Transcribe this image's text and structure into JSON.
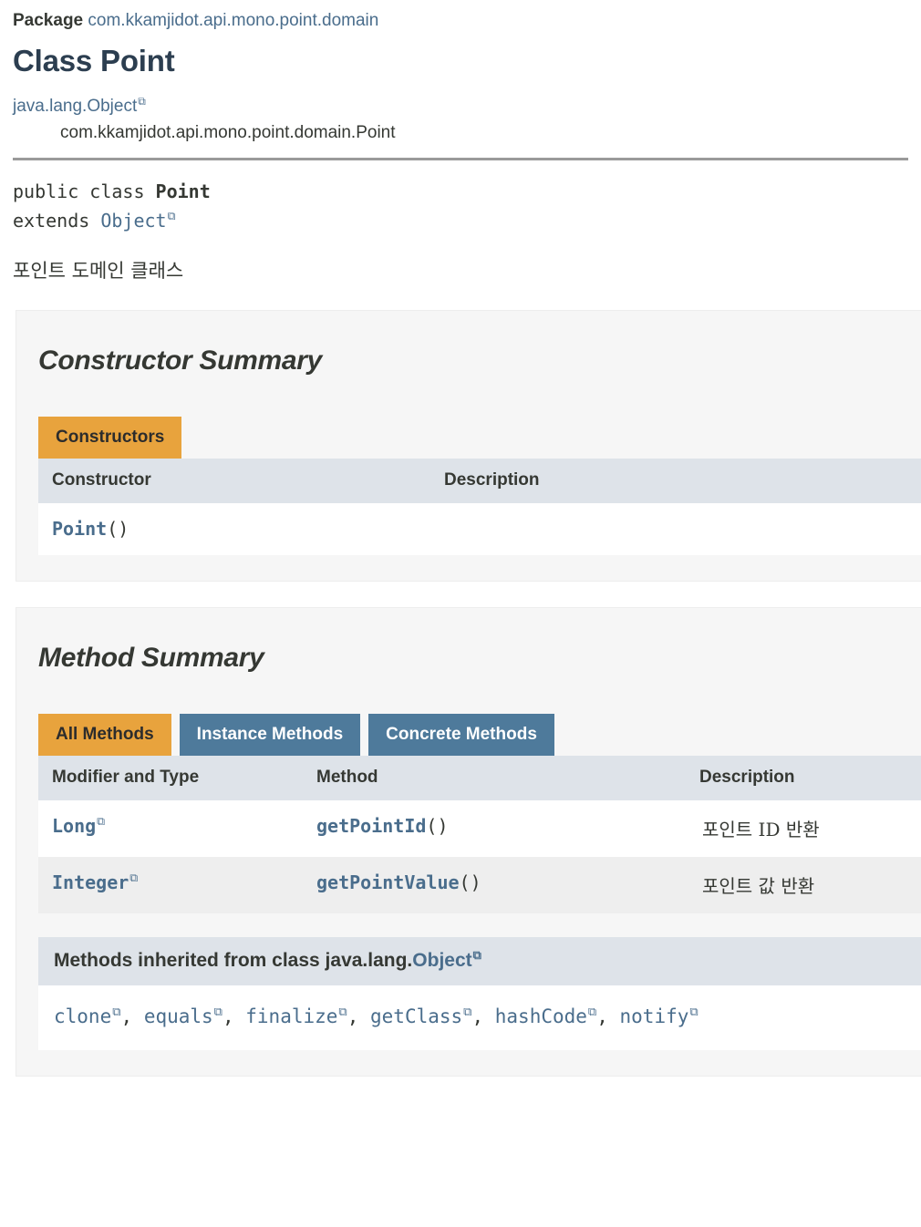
{
  "header": {
    "package_label": "Package",
    "package_name": "com.kkamjidot.api.mono.point.domain",
    "class_title": "Class Point",
    "inheritance": {
      "parent": "java.lang.Object",
      "self": "com.kkamjidot.api.mono.point.domain.Point"
    }
  },
  "declaration": {
    "modifiers": "public class ",
    "class_name": "Point",
    "extends_keyword": "extends ",
    "superclass": "Object"
  },
  "class_description": "포인트 도메인 클래스",
  "constructor_summary": {
    "title": "Constructor Summary",
    "tab_label": "Constructors",
    "columns": [
      "Constructor",
      "Description"
    ],
    "rows": [
      {
        "name": "Point",
        "signature": "()",
        "description": ""
      }
    ]
  },
  "method_summary": {
    "title": "Method Summary",
    "tabs": [
      {
        "label": "All Methods",
        "active": true
      },
      {
        "label": "Instance Methods",
        "active": false
      },
      {
        "label": "Concrete Methods",
        "active": false
      }
    ],
    "columns": [
      "Modifier and Type",
      "Method",
      "Description"
    ],
    "rows": [
      {
        "type": "Long",
        "type_external": true,
        "method": "getPointId",
        "signature": "()",
        "description": "포인트 ID 반환"
      },
      {
        "type": "Integer",
        "type_external": true,
        "method": "getPointValue",
        "signature": "()",
        "description": "포인트 값 반환"
      }
    ],
    "inherited": {
      "heading_prefix": "Methods inherited from class java.lang.",
      "heading_link": "Object",
      "methods": [
        "clone",
        "equals",
        "finalize",
        "getClass",
        "hashCode",
        "notify"
      ]
    }
  },
  "icons": {
    "external_link": "⧉"
  },
  "colors": {
    "link": "#4a6d8c",
    "tab_active_bg": "#e8a33d",
    "tab_inactive_bg": "#4e7a9b",
    "table_header_bg": "#dee3e9",
    "panel_bg": "#f6f6f6",
    "row_alt_bg": "#eeeeee",
    "title": "#2c3e50"
  }
}
